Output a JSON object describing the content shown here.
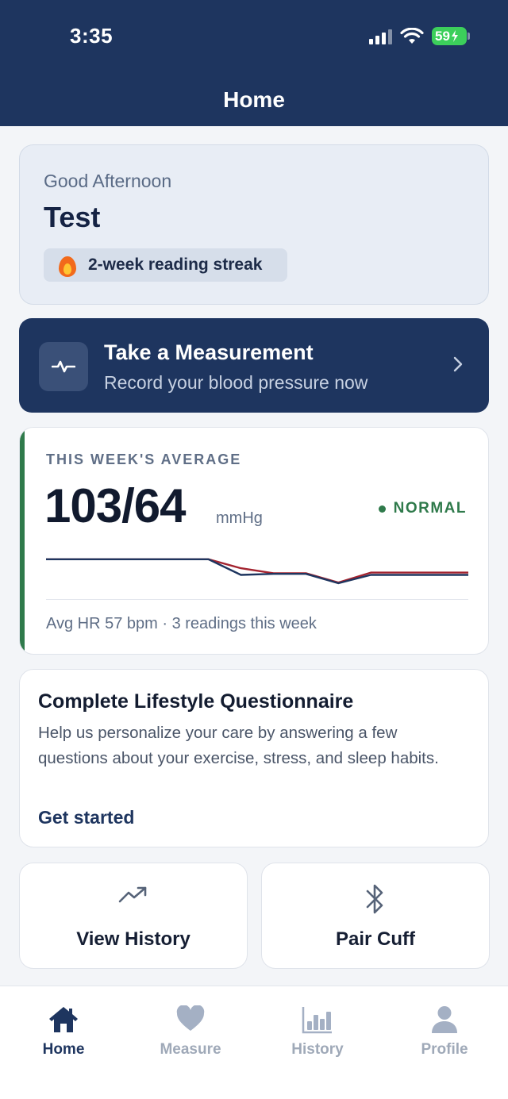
{
  "status_bar": {
    "time": "3:35",
    "battery": "59"
  },
  "header": {
    "title": "Home"
  },
  "greeting": {
    "subtitle": "Good Afternoon",
    "name": "Test",
    "streak": "2-week reading streak"
  },
  "measure": {
    "title": "Take a Measurement",
    "subtitle": "Record your blood pressure now"
  },
  "weekly_average": {
    "label": "THIS WEEK'S AVERAGE",
    "value": "103/64",
    "unit": "mmHg",
    "status": "NORMAL",
    "footer": "Avg HR 57 bpm · 3 readings this week",
    "status_color": "#2f7a4b"
  },
  "chart_data": {
    "type": "line",
    "series": [
      {
        "color": "#1e355f",
        "values": [
          0.72,
          0.72,
          0.72,
          0.72,
          0.72,
          0.72,
          0.25,
          0.28,
          0.28,
          0.0,
          0.25,
          0.25,
          0.25,
          0.25
        ]
      },
      {
        "color": "#a3232f",
        "values": [
          0.72,
          0.72,
          0.72,
          0.72,
          0.72,
          0.72,
          0.45,
          0.3,
          0.3,
          0.02,
          0.32,
          0.32,
          0.32,
          0.32
        ]
      }
    ]
  },
  "questionnaire": {
    "title": "Complete Lifestyle Questionnaire",
    "body": "Help us personalize your care by answering a few questions about your exercise, stress, and sleep habits.",
    "cta": "Get started"
  },
  "tiles": [
    {
      "label": "View History",
      "icon": "trending-up-icon"
    },
    {
      "label": "Pair Cuff",
      "icon": "bluetooth-icon"
    }
  ],
  "tabs": [
    {
      "label": "Home",
      "icon": "home-icon",
      "active": true
    },
    {
      "label": "Measure",
      "icon": "heart-icon",
      "active": false
    },
    {
      "label": "History",
      "icon": "bar-chart-icon",
      "active": false
    },
    {
      "label": "Profile",
      "icon": "person-icon",
      "active": false
    }
  ],
  "colors": {
    "primary": "#1e355f",
    "background": "#f3f5f8",
    "accent_green": "#2f7a4b",
    "accent_red": "#a3232f"
  }
}
